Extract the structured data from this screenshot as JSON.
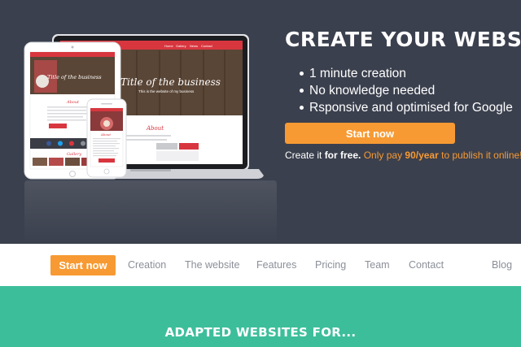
{
  "hero": {
    "title": "CREATE YOUR WEBSITE",
    "features": [
      "1 minute creation",
      "No knowledge needed",
      "Rsponsive and optimised for Google"
    ],
    "cta_label": "Start now",
    "subline": {
      "part1": "Create it ",
      "part2": "for free.",
      "part3": " Only pay ",
      "part4": "90/year",
      "part5": " to publish it online!"
    },
    "mockup": {
      "laptop_heading": "Title of the business",
      "laptop_subheading": "This is the website of my business",
      "laptop_nav": [
        "Home",
        "Gallery",
        "News",
        "Contact"
      ],
      "tablet_heading": "Title of the business",
      "tablet_section": "About",
      "phone_section": "About",
      "gallery_label": "Gallery"
    }
  },
  "nav": {
    "start_label": "Start now",
    "items": [
      "Creation",
      "The website",
      "Features",
      "Pricing",
      "Team",
      "Contact",
      "Blog"
    ]
  },
  "section": {
    "title": "ADAPTED WEBSITES FOR..."
  },
  "colors": {
    "hero_bg": "#3b404e",
    "accent": "#f79a33",
    "teal": "#3dbe9b",
    "mock_red": "#d8363f"
  }
}
